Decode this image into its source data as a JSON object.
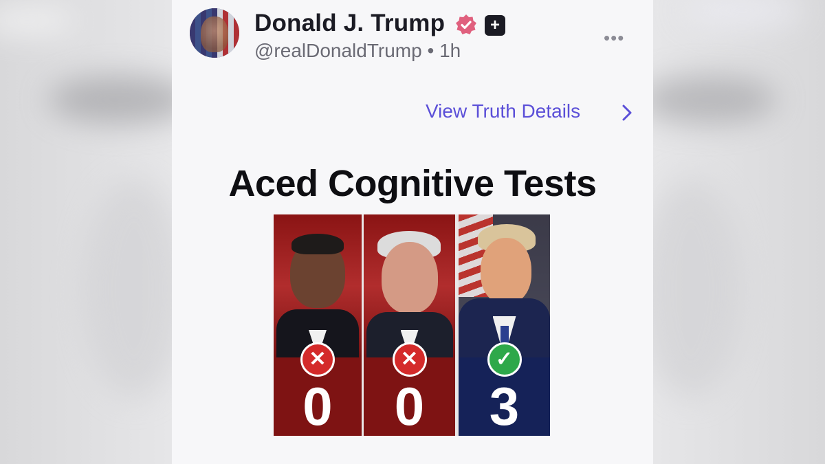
{
  "author": {
    "name": "Donald J. Trump",
    "handle": "@realDonaldTrump",
    "time_ago": "1h"
  },
  "actions": {
    "view_details_label": "View Truth Details"
  },
  "post": {
    "title": "Aced Cognitive Tests",
    "cards": [
      {
        "mark": "✕",
        "score": "0"
      },
      {
        "mark": "✕",
        "score": "0"
      },
      {
        "mark": "✓",
        "score": "3"
      }
    ]
  },
  "colors": {
    "link": "#5b4fd8",
    "verified": "#e0607e",
    "fail_red": "#d42a2a",
    "pass_green": "#2ea84a",
    "card_red": "#7e1313",
    "card_navy": "#152258"
  }
}
